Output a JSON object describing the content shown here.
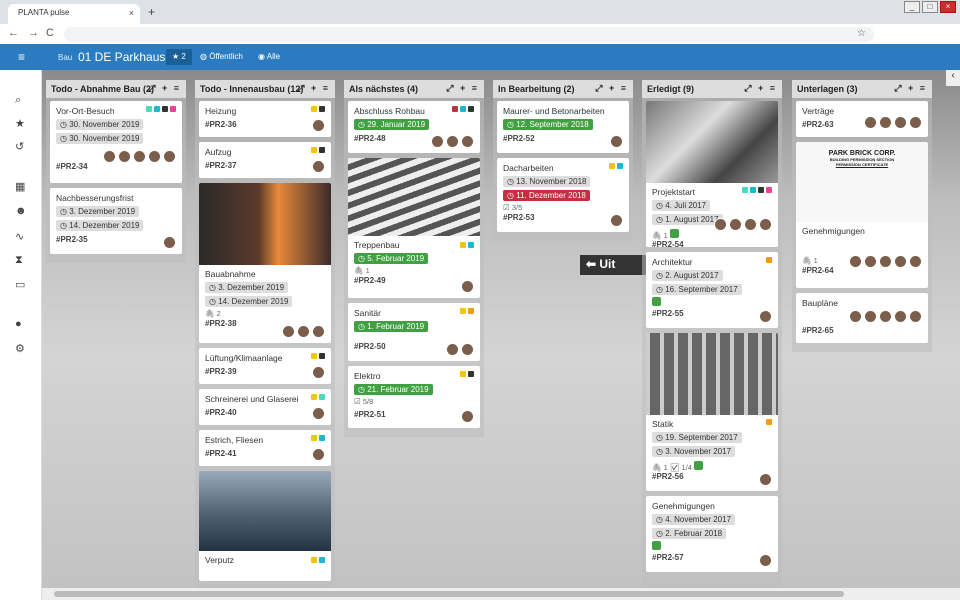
{
  "browser": {
    "tab_title": "PLANTA pulse",
    "close": "×",
    "new_tab": "+",
    "back": "←",
    "forward": "→",
    "reload": "C",
    "bookmark": "☆",
    "min": "_",
    "max": "□",
    "win_close": "×"
  },
  "topbar": {
    "breadcrumb": "Bau",
    "title": "01 DE Parkhaus",
    "favorites_count": "2",
    "public_label": "Öffentlich",
    "all_label": "Alle"
  },
  "colors": {
    "green": "#41a041",
    "red": "#c43042",
    "blue_bar": "#2a7bbf",
    "yellow": "#f1c40f",
    "orange": "#f39c12",
    "cyan": "#1fb6d4",
    "black": "#333333",
    "pink": "#e84393",
    "mint": "#48dbbf"
  },
  "columns": [
    {
      "title": "Todo - Abnahme Bau",
      "count": "(2)",
      "cards": [
        {
          "title": "Vor-Ort-Besuch",
          "dates": [
            "30. November 2019",
            "30. November 2019"
          ],
          "id": "#PR2-34"
        },
        {
          "title": "Nachbesserungsfrist",
          "dates": [
            "3. Dezember 2019",
            "14. Dezember 2019"
          ],
          "id": "#PR2-35"
        }
      ]
    },
    {
      "title": "Todo - Innenausbau",
      "count": "(12)",
      "cards": [
        {
          "title": "Heizung",
          "id": "#PR2-36"
        },
        {
          "title": "Aufzug",
          "id": "#PR2-37"
        },
        {
          "title": "Bauabnahme",
          "dates": [
            "3. Dezember 2019",
            "14. Dezember 2019"
          ],
          "attach": "2",
          "id": "#PR2-38"
        },
        {
          "title": "Lüftung/Klimaanlage",
          "id": "#PR2-39"
        },
        {
          "title": "Schreinerei und Glaserei",
          "id": "#PR2-40"
        },
        {
          "title": "Estrich, Fliesen",
          "id": "#PR2-41"
        },
        {
          "title": "Verputz"
        }
      ]
    },
    {
      "title": "Als nächstes",
      "count": "(4)",
      "cards": [
        {
          "title": "Abschluss Rohbau",
          "dates": [
            "29. Januar 2019"
          ],
          "id": "#PR2-48"
        },
        {
          "title": "Treppenbau",
          "dates": [
            "5. Februar 2019"
          ],
          "attach": "1",
          "id": "#PR2-49"
        },
        {
          "title": "Sanitär",
          "dates": [
            "1. Februar 2019"
          ],
          "id": "#PR2-50"
        },
        {
          "title": "Elektro",
          "dates": [
            "21. Februar 2019"
          ],
          "checklist": "5/8",
          "id": "#PR2-51"
        }
      ]
    },
    {
      "title": "In Bearbeitung",
      "count": "(2)",
      "cards": [
        {
          "title": "Maurer- und Betonarbeiten",
          "dates": [
            "12. September 2018"
          ],
          "id": "#PR2-52"
        },
        {
          "title": "Dacharbeiten",
          "dates": [
            "13. November 2018",
            "11. Dezember 2018"
          ],
          "checklist": "3/5",
          "id": "#PR2-53"
        }
      ]
    },
    {
      "title": "Erledigt",
      "count": "(9)",
      "cards": [
        {
          "title": "Projektstart",
          "dates": [
            "4. Juli 2017",
            "1. August 2017"
          ],
          "attach": "1",
          "id": "#PR2-54"
        },
        {
          "title": "Architektur",
          "dates": [
            "2. August 2017",
            "16. September 2017"
          ],
          "id": "#PR2-55"
        },
        {
          "title": "Statik",
          "dates": [
            "19. September 2017",
            "3. November 2017"
          ],
          "attach": "1",
          "checklist": "1/4",
          "id": "#PR2-56"
        },
        {
          "title": "Genehmigungen",
          "dates": [
            "4. November 2017",
            "2. Februar 2018"
          ],
          "id": "#PR2-57"
        }
      ]
    },
    {
      "title": "Unterlagen",
      "count": "(3)",
      "cards": [
        {
          "title": "Verträge",
          "id": "#PR2-63"
        },
        {
          "title": "Genehmigungen",
          "attach": "1",
          "id": "#PR2-64",
          "doc_heading": "PARK BRICK CORP.",
          "doc_sub": "BUILDING PERMISSION SECTION",
          "doc_sub2": "PERMISSION CERTIFICATE"
        },
        {
          "title": "Baupläne",
          "id": "#PR2-65"
        }
      ]
    }
  ],
  "signage": "Uit",
  "col_actions": "⤢ + ≡"
}
